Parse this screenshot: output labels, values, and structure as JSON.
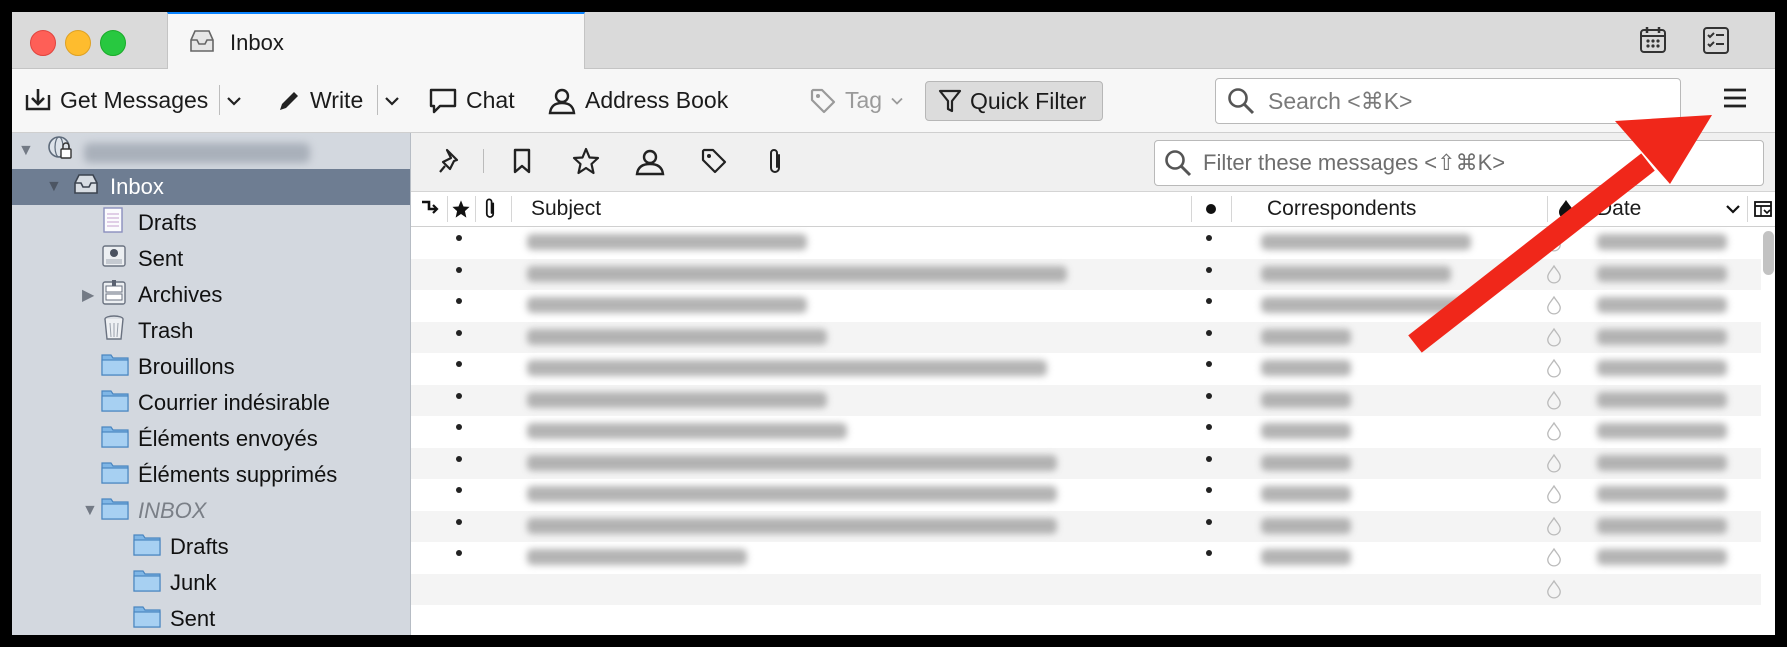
{
  "tabs": [
    {
      "label": "Inbox"
    }
  ],
  "toolbar": {
    "get_messages": "Get Messages",
    "write": "Write",
    "chat": "Chat",
    "address_book": "Address Book",
    "tag": "Tag",
    "quick_filter": "Quick Filter",
    "search_placeholder": "Search <⌘K>"
  },
  "sidebar": {
    "items": [
      {
        "label": "Inbox"
      },
      {
        "label": "Drafts"
      },
      {
        "label": "Sent"
      },
      {
        "label": "Archives"
      },
      {
        "label": "Trash"
      },
      {
        "label": "Brouillons"
      },
      {
        "label": "Courrier indésirable"
      },
      {
        "label": "Éléments envoyés"
      },
      {
        "label": "Éléments supprimés"
      },
      {
        "label": "INBOX"
      },
      {
        "label": "Drafts"
      },
      {
        "label": "Junk"
      },
      {
        "label": "Sent"
      }
    ]
  },
  "filter": {
    "placeholder": "Filter these messages <⇧⌘K>"
  },
  "columns": {
    "subject": "Subject",
    "correspondents": "Correspondents",
    "date": "Date"
  },
  "colors": {
    "accent": "#0a84ff",
    "selected_folder": "#6e7d92",
    "arrow": "#f0271a",
    "close": "#fe5f57",
    "minimize": "#febc2e",
    "zoom": "#28c840"
  }
}
